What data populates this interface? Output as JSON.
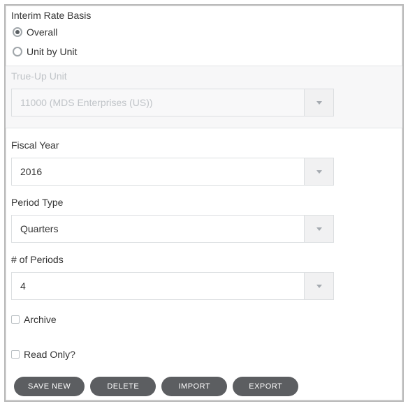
{
  "group": {
    "title": "Interim Rate Basis",
    "options": {
      "overall": "Overall",
      "unitByUnit": "Unit by Unit"
    },
    "selected": "overall"
  },
  "trueUp": {
    "label": "True-Up Unit",
    "value": "11000 (MDS Enterprises (US))"
  },
  "fiscalYear": {
    "label": "Fiscal Year",
    "value": "2016"
  },
  "periodType": {
    "label": "Period Type",
    "value": "Quarters"
  },
  "numPeriods": {
    "label": "# of Periods",
    "value": "4"
  },
  "archive": {
    "label": "Archive",
    "checked": false
  },
  "readOnly": {
    "label": "Read Only?",
    "checked": false
  },
  "buttons": {
    "saveNew": "SAVE NEW",
    "delete": "DELETE",
    "import": "IMPORT",
    "export": "EXPORT"
  }
}
